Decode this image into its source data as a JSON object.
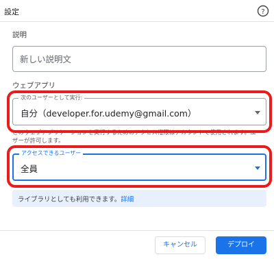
{
  "header": {
    "title": "設定",
    "help_icon": "help-circle-icon"
  },
  "description": {
    "label": "説明",
    "placeholder": "新しい説明文",
    "value": ""
  },
  "web_app": {
    "section_label": "ウェブアプリ",
    "execute_as": {
      "legend": "次のユーザーとして実行:",
      "value": "自分（developer.for.udemy@gmail.com）"
    },
    "hint": "このウェブアプリケーションを実行するためのアクセス権限はアカウントで使用されます。ユーザーが許可します。",
    "who_has_access": {
      "legend": "アクセスできるユーザー",
      "value": "全員"
    }
  },
  "info": {
    "text": "ライブラリとしても利用できます。",
    "link": "詳細"
  },
  "footer": {
    "cancel_label": "キャンセル",
    "deploy_label": "デプロイ"
  },
  "colors": {
    "accent": "#1a73e8",
    "highlight": "#e81c1c",
    "info_bg": "#e8f0fe"
  }
}
